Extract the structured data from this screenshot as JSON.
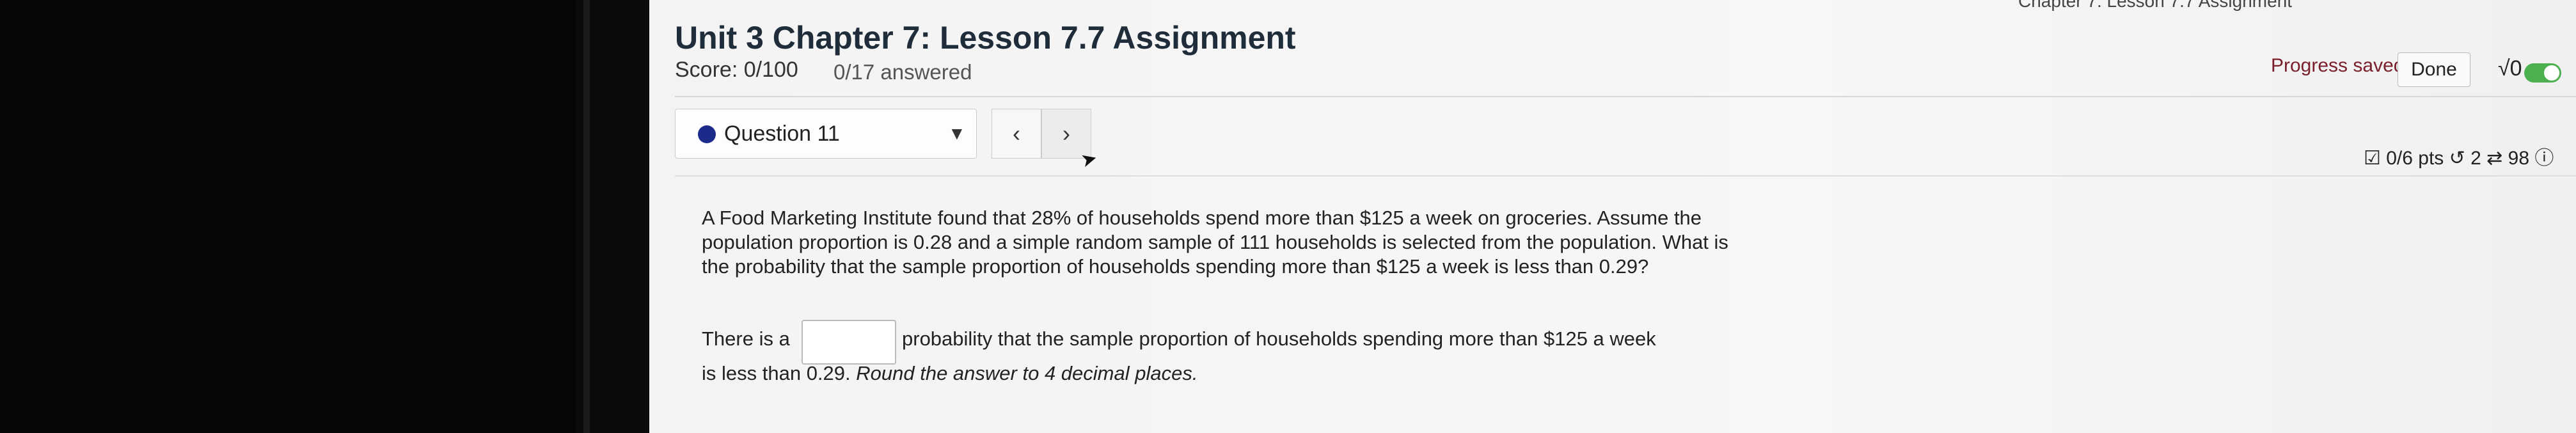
{
  "window": {
    "tab_title_partial": "Chapter 7: Lesson 7.7 Assignment"
  },
  "assignment": {
    "title": "Unit 3 Chapter 7: Lesson 7.7 Assignment",
    "score": "Score: 0/100",
    "answered": "0/17 answered"
  },
  "toolbar": {
    "progress_saved": "Progress saved",
    "done_label": "Done",
    "math_icon_label": "√0"
  },
  "question_nav": {
    "selected": "Question 11",
    "prev_icon": "‹",
    "next_icon": "›"
  },
  "question_meta": {
    "points": "0/6 pts",
    "retries": "2",
    "attempts": "98"
  },
  "question": {
    "text": "A Food Marketing Institute found that 28% of households spend more than $125 a week on groceries. Assume the population proportion is 0.28 and a simple random sample of 111 households is selected from the population. What is the probability that the sample proportion of households spending more than $125 a week is less than 0.29?",
    "answer_prefix": "There is a",
    "answer_value": "",
    "answer_suffix": "probability that the sample proportion of households spending more than $125 a week",
    "answer_line2": "is less than 0.29.",
    "answer_instruction": "Round the answer to 4 decimal places."
  },
  "colors": {
    "accent_dot": "#1c2a8a",
    "saved_text": "#7a1f2b",
    "toggle_on": "#4caf50"
  }
}
